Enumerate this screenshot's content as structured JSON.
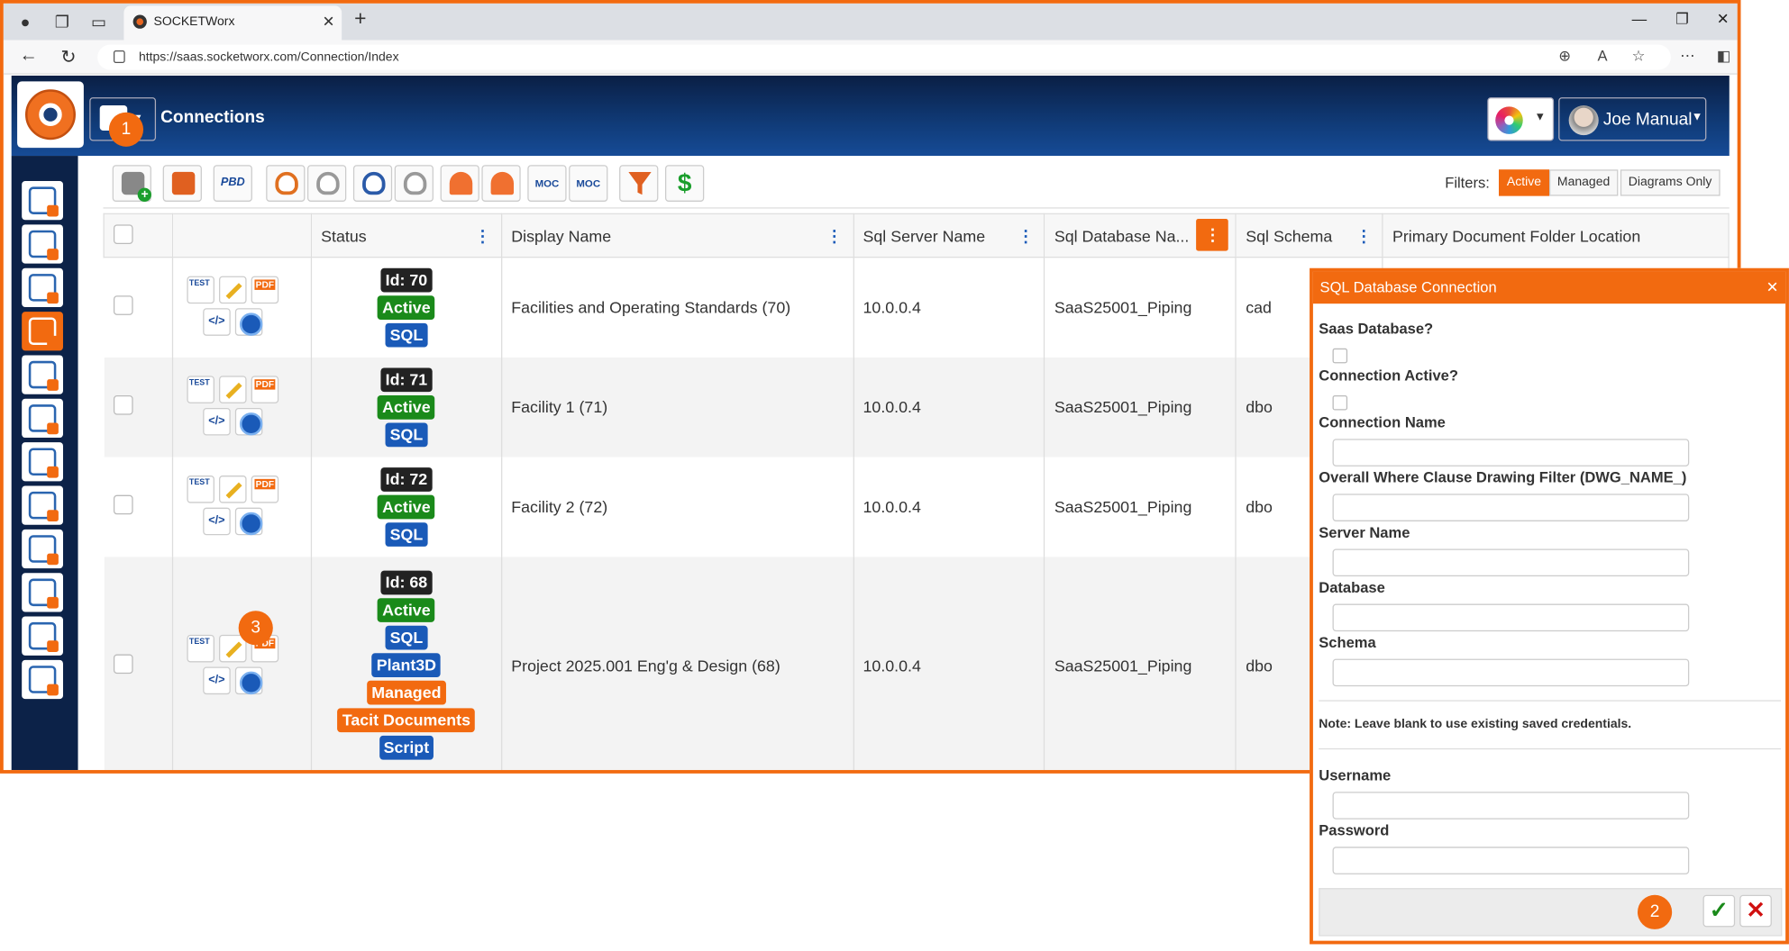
{
  "browser": {
    "tab_title": "SOCKETWorx",
    "url": "https://saas.socketworx.com/Connection/Index"
  },
  "header": {
    "page_title": "Connections",
    "user_name": "Joe Manual"
  },
  "toolbar": {
    "pbd_label": "PBD",
    "moc_label": "MOC",
    "dollar_label": "$"
  },
  "filters": {
    "label": "Filters:",
    "options": [
      "Active",
      "Managed",
      "Diagrams Only"
    ],
    "active": "Active"
  },
  "grid": {
    "columns": [
      "Status",
      "Display Name",
      "Sql Server Name",
      "Sql Database Na...",
      "Sql Schema",
      "Primary Document Folder Location"
    ],
    "rows": [
      {
        "id": "Id: 70",
        "badges": [
          "Active",
          "SQL"
        ],
        "display_name": "Facilities and Operating Standards (70)",
        "server": "10.0.0.4",
        "database": "SaaS25001_Piping",
        "schema": "cad"
      },
      {
        "id": "Id: 71",
        "badges": [
          "Active",
          "SQL"
        ],
        "display_name": "Facility 1 (71)",
        "server": "10.0.0.4",
        "database": "SaaS25001_Piping",
        "schema": "dbo"
      },
      {
        "id": "Id: 72",
        "badges": [
          "Active",
          "SQL"
        ],
        "display_name": "Facility 2 (72)",
        "server": "10.0.0.4",
        "database": "SaaS25001_Piping",
        "schema": "dbo"
      },
      {
        "id": "Id: 68",
        "badges": [
          "Active",
          "SQL",
          "Plant3D",
          "Managed",
          "Tacit Documents",
          "Script"
        ],
        "display_name": "Project 2025.001 Eng'g & Design (68)",
        "server": "10.0.0.4",
        "database": "SaaS25001_Piping",
        "schema": "dbo"
      }
    ]
  },
  "dialog": {
    "title": "SQL Database Connection",
    "saas_label": "Saas Database?",
    "active_label": "Connection Active?",
    "name_label": "Connection Name",
    "where_label": "Overall Where Clause Drawing Filter (DWG_NAME_)",
    "server_label": "Server Name",
    "database_label": "Database",
    "schema_label": "Schema",
    "note": "Note: Leave blank to use existing saved credentials.",
    "username_label": "Username",
    "password_label": "Password"
  },
  "callouts": [
    "1",
    "2",
    "3"
  ],
  "colors": {
    "accent": "#f26a10",
    "header": "#103b78",
    "active": "#1a8a1a",
    "sql": "#1a5ab8"
  }
}
